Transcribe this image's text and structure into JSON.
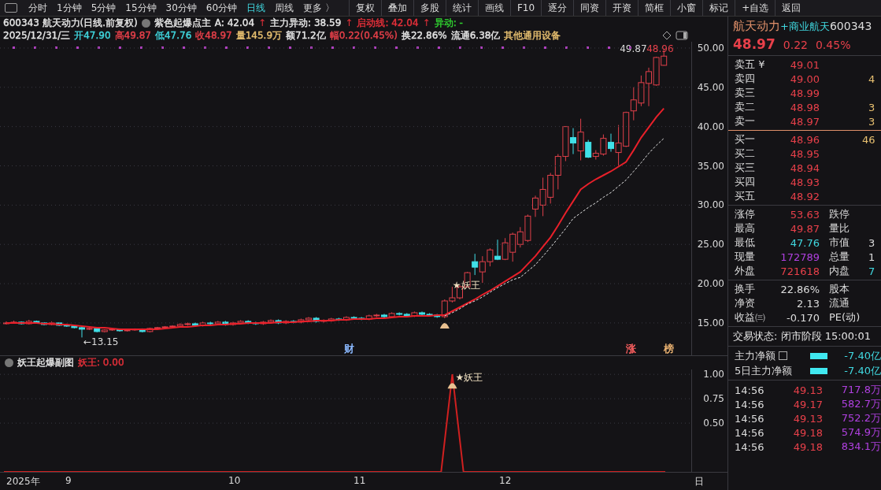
{
  "toolbar": {
    "periods": [
      {
        "label": "分时",
        "selected": false
      },
      {
        "label": "1分钟",
        "selected": false
      },
      {
        "label": "5分钟",
        "selected": false
      },
      {
        "label": "15分钟",
        "selected": false
      },
      {
        "label": "30分钟",
        "selected": false
      },
      {
        "label": "60分钟",
        "selected": false
      },
      {
        "label": "日线",
        "selected": true
      },
      {
        "label": "周线",
        "selected": false
      },
      {
        "label": "更多 〉",
        "selected": false
      }
    ],
    "buttons": [
      "复权",
      "叠加",
      "多股",
      "统计",
      "画线",
      "F10",
      "逐分",
      "同资",
      "开资",
      "简框",
      "小窗",
      "标记",
      "+自选",
      "返回"
    ]
  },
  "header": {
    "title": "600343 航天动力(日线.前复权)",
    "indicator": "紫色起爆点主",
    "readings": [
      {
        "text": "A: 42.04",
        "arrow": "↑",
        "color": "#e6e6e6"
      },
      {
        "text": "主力异动: 38.59",
        "arrow": "↑",
        "color": "#e6e6e6"
      },
      {
        "text": "启动线: 42.04",
        "arrow": "↑",
        "color": "#e8303a"
      },
      {
        "text": "异动: -",
        "color": "#30d030"
      }
    ]
  },
  "quote": [
    {
      "text": "2025/12/31/三",
      "color": "#e6e6e6"
    },
    {
      "text": "开47.90",
      "color": "#40d8e0"
    },
    {
      "text": "高49.87",
      "color": "#e8404a"
    },
    {
      "text": "低47.76",
      "color": "#40d8e0"
    },
    {
      "text": "收48.97",
      "color": "#e8404a"
    },
    {
      "text": "量145.9万",
      "color": "#e8c070"
    },
    {
      "text": "额71.2亿",
      "color": "#e6e6e6"
    },
    {
      "text": "幅0.22(0.45%)",
      "color": "#e8404a"
    },
    {
      "text": "换22.86%",
      "color": "#e6e6e6"
    },
    {
      "text": "流通6.38亿",
      "color": "#e6e6e6"
    },
    {
      "text": "其他通用设备",
      "color": "#e8c070"
    }
  ],
  "main_chart": {
    "chart_data": {
      "type": "candlestick",
      "ohlc": [
        [
          14.9,
          15.2,
          14.8,
          15.0
        ],
        [
          15.0,
          15.3,
          14.9,
          15.1
        ],
        [
          15.1,
          15.2,
          14.8,
          14.9
        ],
        [
          14.9,
          15.4,
          14.8,
          15.2
        ],
        [
          15.2,
          15.3,
          14.9,
          15.0
        ],
        [
          15.0,
          15.1,
          14.7,
          14.8
        ],
        [
          14.8,
          15.2,
          14.7,
          15.0
        ],
        [
          15.0,
          15.1,
          14.6,
          14.7
        ],
        [
          14.7,
          14.9,
          14.5,
          14.6
        ],
        [
          14.6,
          14.7,
          14.3,
          14.4
        ],
        [
          14.4,
          14.5,
          13.15,
          14.2
        ],
        [
          14.2,
          14.5,
          14.1,
          14.3
        ],
        [
          14.3,
          14.4,
          13.8,
          13.9
        ],
        [
          13.9,
          14.2,
          13.8,
          14.1
        ],
        [
          14.1,
          14.3,
          14.0,
          14.2
        ],
        [
          14.2,
          14.3,
          13.9,
          14.0
        ],
        [
          14.0,
          14.2,
          13.9,
          14.1
        ],
        [
          14.1,
          14.3,
          14.0,
          14.2
        ],
        [
          14.2,
          14.3,
          13.8,
          13.9
        ],
        [
          13.9,
          14.4,
          13.8,
          14.3
        ],
        [
          14.3,
          14.5,
          14.2,
          14.4
        ],
        [
          14.4,
          14.6,
          14.3,
          14.5
        ],
        [
          14.5,
          14.7,
          14.4,
          14.6
        ],
        [
          14.6,
          14.95,
          14.45,
          14.8
        ],
        [
          14.8,
          15.05,
          14.65,
          14.9
        ],
        [
          14.9,
          15.05,
          14.55,
          14.7
        ],
        [
          14.7,
          15.15,
          14.55,
          15.0
        ],
        [
          15.0,
          15.15,
          14.75,
          14.9
        ],
        [
          14.9,
          15.25,
          14.75,
          15.1
        ],
        [
          15.1,
          15.25,
          14.65,
          14.8
        ],
        [
          14.8,
          15.15,
          14.65,
          15.0
        ],
        [
          15.0,
          15.35,
          14.85,
          15.2
        ],
        [
          15.2,
          15.35,
          14.85,
          15.0
        ],
        [
          15.0,
          15.15,
          14.75,
          14.9
        ],
        [
          14.9,
          15.25,
          14.75,
          15.1
        ],
        [
          15.1,
          15.45,
          14.95,
          15.3
        ],
        [
          15.3,
          15.45,
          14.85,
          15.0
        ],
        [
          15.0,
          15.35,
          14.85,
          15.2
        ],
        [
          15.2,
          15.35,
          14.95,
          15.1
        ],
        [
          15.1,
          15.55,
          14.95,
          15.4
        ],
        [
          15.4,
          15.75,
          15.25,
          15.6
        ],
        [
          15.6,
          15.75,
          15.05,
          15.2
        ],
        [
          15.2,
          15.45,
          15.05,
          15.3
        ],
        [
          15.3,
          15.65,
          15.15,
          15.5
        ],
        [
          15.5,
          15.65,
          15.25,
          15.4
        ],
        [
          15.4,
          15.85,
          15.25,
          15.7
        ],
        [
          15.7,
          15.85,
          15.45,
          15.6
        ],
        [
          15.6,
          15.75,
          15.35,
          15.5
        ],
        [
          15.5,
          16.05,
          15.35,
          15.9
        ],
        [
          15.9,
          16.15,
          15.75,
          16.0
        ],
        [
          16.0,
          16.15,
          15.65,
          15.8
        ],
        [
          15.8,
          16.35,
          15.65,
          16.2
        ],
        [
          16.2,
          16.35,
          15.95,
          16.1
        ],
        [
          16.1,
          16.25,
          15.75,
          15.9
        ],
        [
          15.9,
          16.45,
          15.75,
          16.3
        ],
        [
          16.3,
          16.45,
          15.95,
          16.1
        ],
        [
          16.1,
          16.25,
          15.85,
          16.0
        ],
        [
          16.0,
          16.15,
          15.65,
          15.8
        ],
        [
          15.8,
          18.0,
          15.6,
          17.8
        ],
        [
          17.8,
          19.6,
          17.6,
          18.2
        ],
        [
          18.2,
          19.8,
          18.0,
          19.6
        ],
        [
          19.6,
          21.5,
          19.5,
          21.4
        ],
        [
          22.8,
          23.8,
          21.1,
          22.1
        ],
        [
          21.5,
          23.5,
          20.1,
          22.8
        ],
        [
          22.8,
          24.5,
          22.2,
          24.3
        ],
        [
          23.5,
          25.6,
          23.0,
          23.1
        ],
        [
          23.1,
          25.8,
          23.0,
          25.2
        ],
        [
          24.0,
          26.5,
          22.8,
          26.3
        ],
        [
          25.0,
          27.2,
          24.6,
          26.6
        ],
        [
          25.5,
          28.8,
          25.3,
          28.6
        ],
        [
          29.5,
          31.2,
          28.5,
          30.9
        ],
        [
          30.0,
          33.5,
          28.6,
          32.0
        ],
        [
          31.0,
          34.1,
          30.2,
          33.8
        ],
        [
          33.8,
          36.5,
          32.0,
          36.2
        ],
        [
          36.2,
          40.0,
          35.6,
          40.0
        ],
        [
          38.6,
          39.8,
          36.5,
          37.9
        ],
        [
          36.9,
          41.0,
          35.7,
          39.3
        ],
        [
          38.0,
          38.3,
          36.0,
          36.1
        ],
        [
          36.2,
          37.0,
          35.8,
          36.6
        ],
        [
          36.5,
          39.0,
          36.3,
          38.5
        ],
        [
          38.0,
          39.1,
          36.8,
          37.2
        ],
        [
          36.7,
          40.2,
          35.0,
          37.9
        ],
        [
          37.5,
          41.9,
          37.4,
          41.8
        ],
        [
          42.0,
          45.0,
          40.8,
          43.4
        ],
        [
          43.0,
          46.5,
          42.6,
          45.6
        ],
        [
          45.5,
          47.5,
          42.6,
          47.0
        ],
        [
          45.3,
          48.9,
          45.2,
          48.8
        ],
        [
          47.8,
          49.87,
          47.76,
          48.97
        ]
      ]
    },
    "averages": {
      "chart_data": {
        "type": "line",
        "ylim": [
          10.88,
          50.8
        ],
        "grid": true,
        "yticks": [
          {
            "value": 50,
            "label": "50.00"
          },
          {
            "value": 45,
            "label": "45.00"
          },
          {
            "value": 40,
            "label": "40.00"
          },
          {
            "value": 35,
            "label": "35.00"
          },
          {
            "value": 30,
            "label": "30.00"
          },
          {
            "value": 25,
            "label": "25.00"
          },
          {
            "value": 20,
            "label": "20.00"
          },
          {
            "value": 15,
            "label": "15.00"
          }
        ],
        "series": [
          {
            "color": "#e8202a",
            "line_style": "solid",
            "values": [
              15.0,
              15.0,
              15.0,
              15.0,
              15.0,
              14.9,
              14.9,
              14.8,
              14.8,
              14.7,
              14.6,
              14.5,
              14.4,
              14.4,
              14.3,
              14.2,
              14.2,
              14.2,
              14.2,
              14.2,
              14.2,
              14.3,
              14.4,
              14.5,
              14.5,
              14.6,
              14.7,
              14.7,
              14.8,
              14.8,
              14.9,
              14.9,
              15.0,
              15.0,
              15.0,
              15.0,
              15.1,
              15.1,
              15.1,
              15.2,
              15.2,
              15.3,
              15.3,
              15.3,
              15.4,
              15.4,
              15.5,
              15.5,
              15.5,
              15.6,
              15.6,
              15.7,
              15.8,
              15.8,
              15.9,
              15.9,
              15.9,
              16.0,
              16.0,
              16.5,
              17.0,
              17.5,
              18.0,
              18.6,
              19.1,
              19.7,
              20.3,
              20.9,
              21.5,
              22.5,
              23.5,
              24.7,
              25.9,
              27.4,
              29.0,
              30.5,
              32.0,
              32.7,
              33.3,
              33.8,
              34.3,
              34.9,
              35.5,
              37.0,
              38.6,
              39.9,
              41.2,
              42.3
            ]
          },
          {
            "color": "#e6e6e6",
            "line_style": "dashed",
            "values": [
              null,
              null,
              null,
              null,
              null,
              null,
              null,
              null,
              null,
              null,
              null,
              null,
              null,
              null,
              null,
              null,
              null,
              null,
              null,
              null,
              null,
              null,
              null,
              null,
              null,
              null,
              null,
              null,
              null,
              null,
              null,
              null,
              null,
              null,
              null,
              null,
              null,
              null,
              null,
              null,
              null,
              null,
              null,
              null,
              null,
              null,
              null,
              null,
              null,
              null,
              null,
              null,
              null,
              null,
              null,
              null,
              null,
              null,
              15.9,
              16.3,
              16.8,
              17.4,
              17.8,
              18.3,
              18.9,
              19.5,
              20.0,
              20.5,
              20.8,
              21.6,
              22.4,
              23.5,
              24.6,
              25.8,
              27.0,
              28.3,
              29.0,
              29.7,
              30.3,
              31.0,
              31.6,
              32.4,
              33.2,
              34.3,
              35.4,
              36.6,
              37.6,
              38.5
            ]
          }
        ]
      }
    },
    "marks": {
      "high": "49.87",
      "close": "48.96",
      "low": "←13.15",
      "signal": "★妖王"
    }
  },
  "events": [
    {
      "label": "财",
      "color": "#8ab8ff"
    },
    {
      "label": "涨",
      "color": "#ff6060"
    },
    {
      "label": "榜",
      "color": "#e8b070"
    }
  ],
  "sub_chart": {
    "title": "妖王起爆副图",
    "reading": "妖王: 0.00",
    "signal": "★妖王",
    "chart_data": {
      "type": "line",
      "ylim": [
        0,
        1.05
      ],
      "grid": true,
      "yticks": [
        {
          "value": 1,
          "label": "1.00"
        },
        {
          "value": 0.75,
          "label": "0.75"
        },
        {
          "value": 0.5,
          "label": "0.50"
        }
      ],
      "values": [
        0,
        0,
        0,
        0,
        0,
        0,
        0,
        0,
        0,
        0,
        0,
        0,
        0,
        0,
        0,
        0,
        0,
        0,
        0,
        0,
        0,
        0,
        0,
        0,
        0,
        0,
        0,
        0,
        0,
        0,
        0,
        0,
        0,
        0,
        0,
        0,
        0,
        0,
        0,
        0,
        1,
        0,
        0,
        0,
        0,
        0,
        0,
        0,
        0,
        0,
        0,
        0,
        0,
        0,
        0,
        0,
        0,
        0,
        0,
        0
      ]
    }
  },
  "time_axis": [
    "2025年",
    "9",
    "10",
    "11",
    "12",
    "日"
  ],
  "quote_panel": {
    "name": "航天动力",
    "concept": "+商业航天",
    "code": "600343",
    "price": "48.97",
    "change": "0.22",
    "percent": "0.45%",
    "sell": [
      {
        "label": "卖五 ¥",
        "price": "49.01"
      },
      {
        "label": "卖四",
        "price": "49.00",
        "volume": "4"
      },
      {
        "label": "卖三",
        "price": "48.99"
      },
      {
        "label": "卖二",
        "price": "48.98",
        "volume": "3"
      },
      {
        "label": "卖一",
        "price": "48.97",
        "volume": "3"
      }
    ],
    "buy": [
      {
        "label": "买一",
        "price": "48.96",
        "volume": "46"
      },
      {
        "label": "买二",
        "price": "48.95"
      },
      {
        "label": "买三",
        "price": "48.94"
      },
      {
        "label": "买四",
        "price": "48.93"
      },
      {
        "label": "买五",
        "price": "48.92"
      }
    ],
    "stats": [
      {
        "label": "涨停",
        "value": "53.63",
        "color": "#e8404a",
        "label2": "跌停"
      },
      {
        "label": "最高",
        "value": "49.87",
        "color": "#e8404a",
        "label2": "量比"
      },
      {
        "label": "最低",
        "value": "47.76",
        "color": "#40d8e0",
        "label2": "市值",
        "value2": {
          "text": "3",
          "color": "#dcdcdc"
        }
      },
      {
        "label": "现量",
        "value": "172789",
        "color": "#b040e0",
        "label2": "总量",
        "value2": {
          "text": "1",
          "color": "#dcdcdc"
        }
      },
      {
        "label": "外盘",
        "value": "721618",
        "color": "#e8404a",
        "label2": "内盘",
        "value2": {
          "text": "7",
          "color": "#40d8e0"
        }
      }
    ],
    "finance": [
      {
        "label": "换手",
        "value": "22.86%",
        "label2": "股本"
      },
      {
        "label": "净资",
        "value": "2.13",
        "label2": "流通"
      },
      {
        "label": "收益㈢",
        "value": "-0.170",
        "label2": "PE(动)"
      }
    ],
    "status": "交易状态: 闭市阶段 15:00:01",
    "flows": [
      {
        "label": "主力净额",
        "value": "-7.40亿",
        "has_menu": true
      },
      {
        "label": "5日主力净额",
        "value": "-7.40亿",
        "has_menu": false
      }
    ],
    "ticks": [
      {
        "time": "14:56",
        "price": "49.13",
        "amount": "717.8万"
      },
      {
        "time": "14:56",
        "price": "49.17",
        "amount": "582.7万"
      },
      {
        "time": "14:56",
        "price": "49.13",
        "amount": "752.2万"
      },
      {
        "time": "14:56",
        "price": "49.18",
        "amount": "574.9万"
      },
      {
        "time": "14:56",
        "price": "49.18",
        "amount": "834.1万"
      }
    ]
  }
}
